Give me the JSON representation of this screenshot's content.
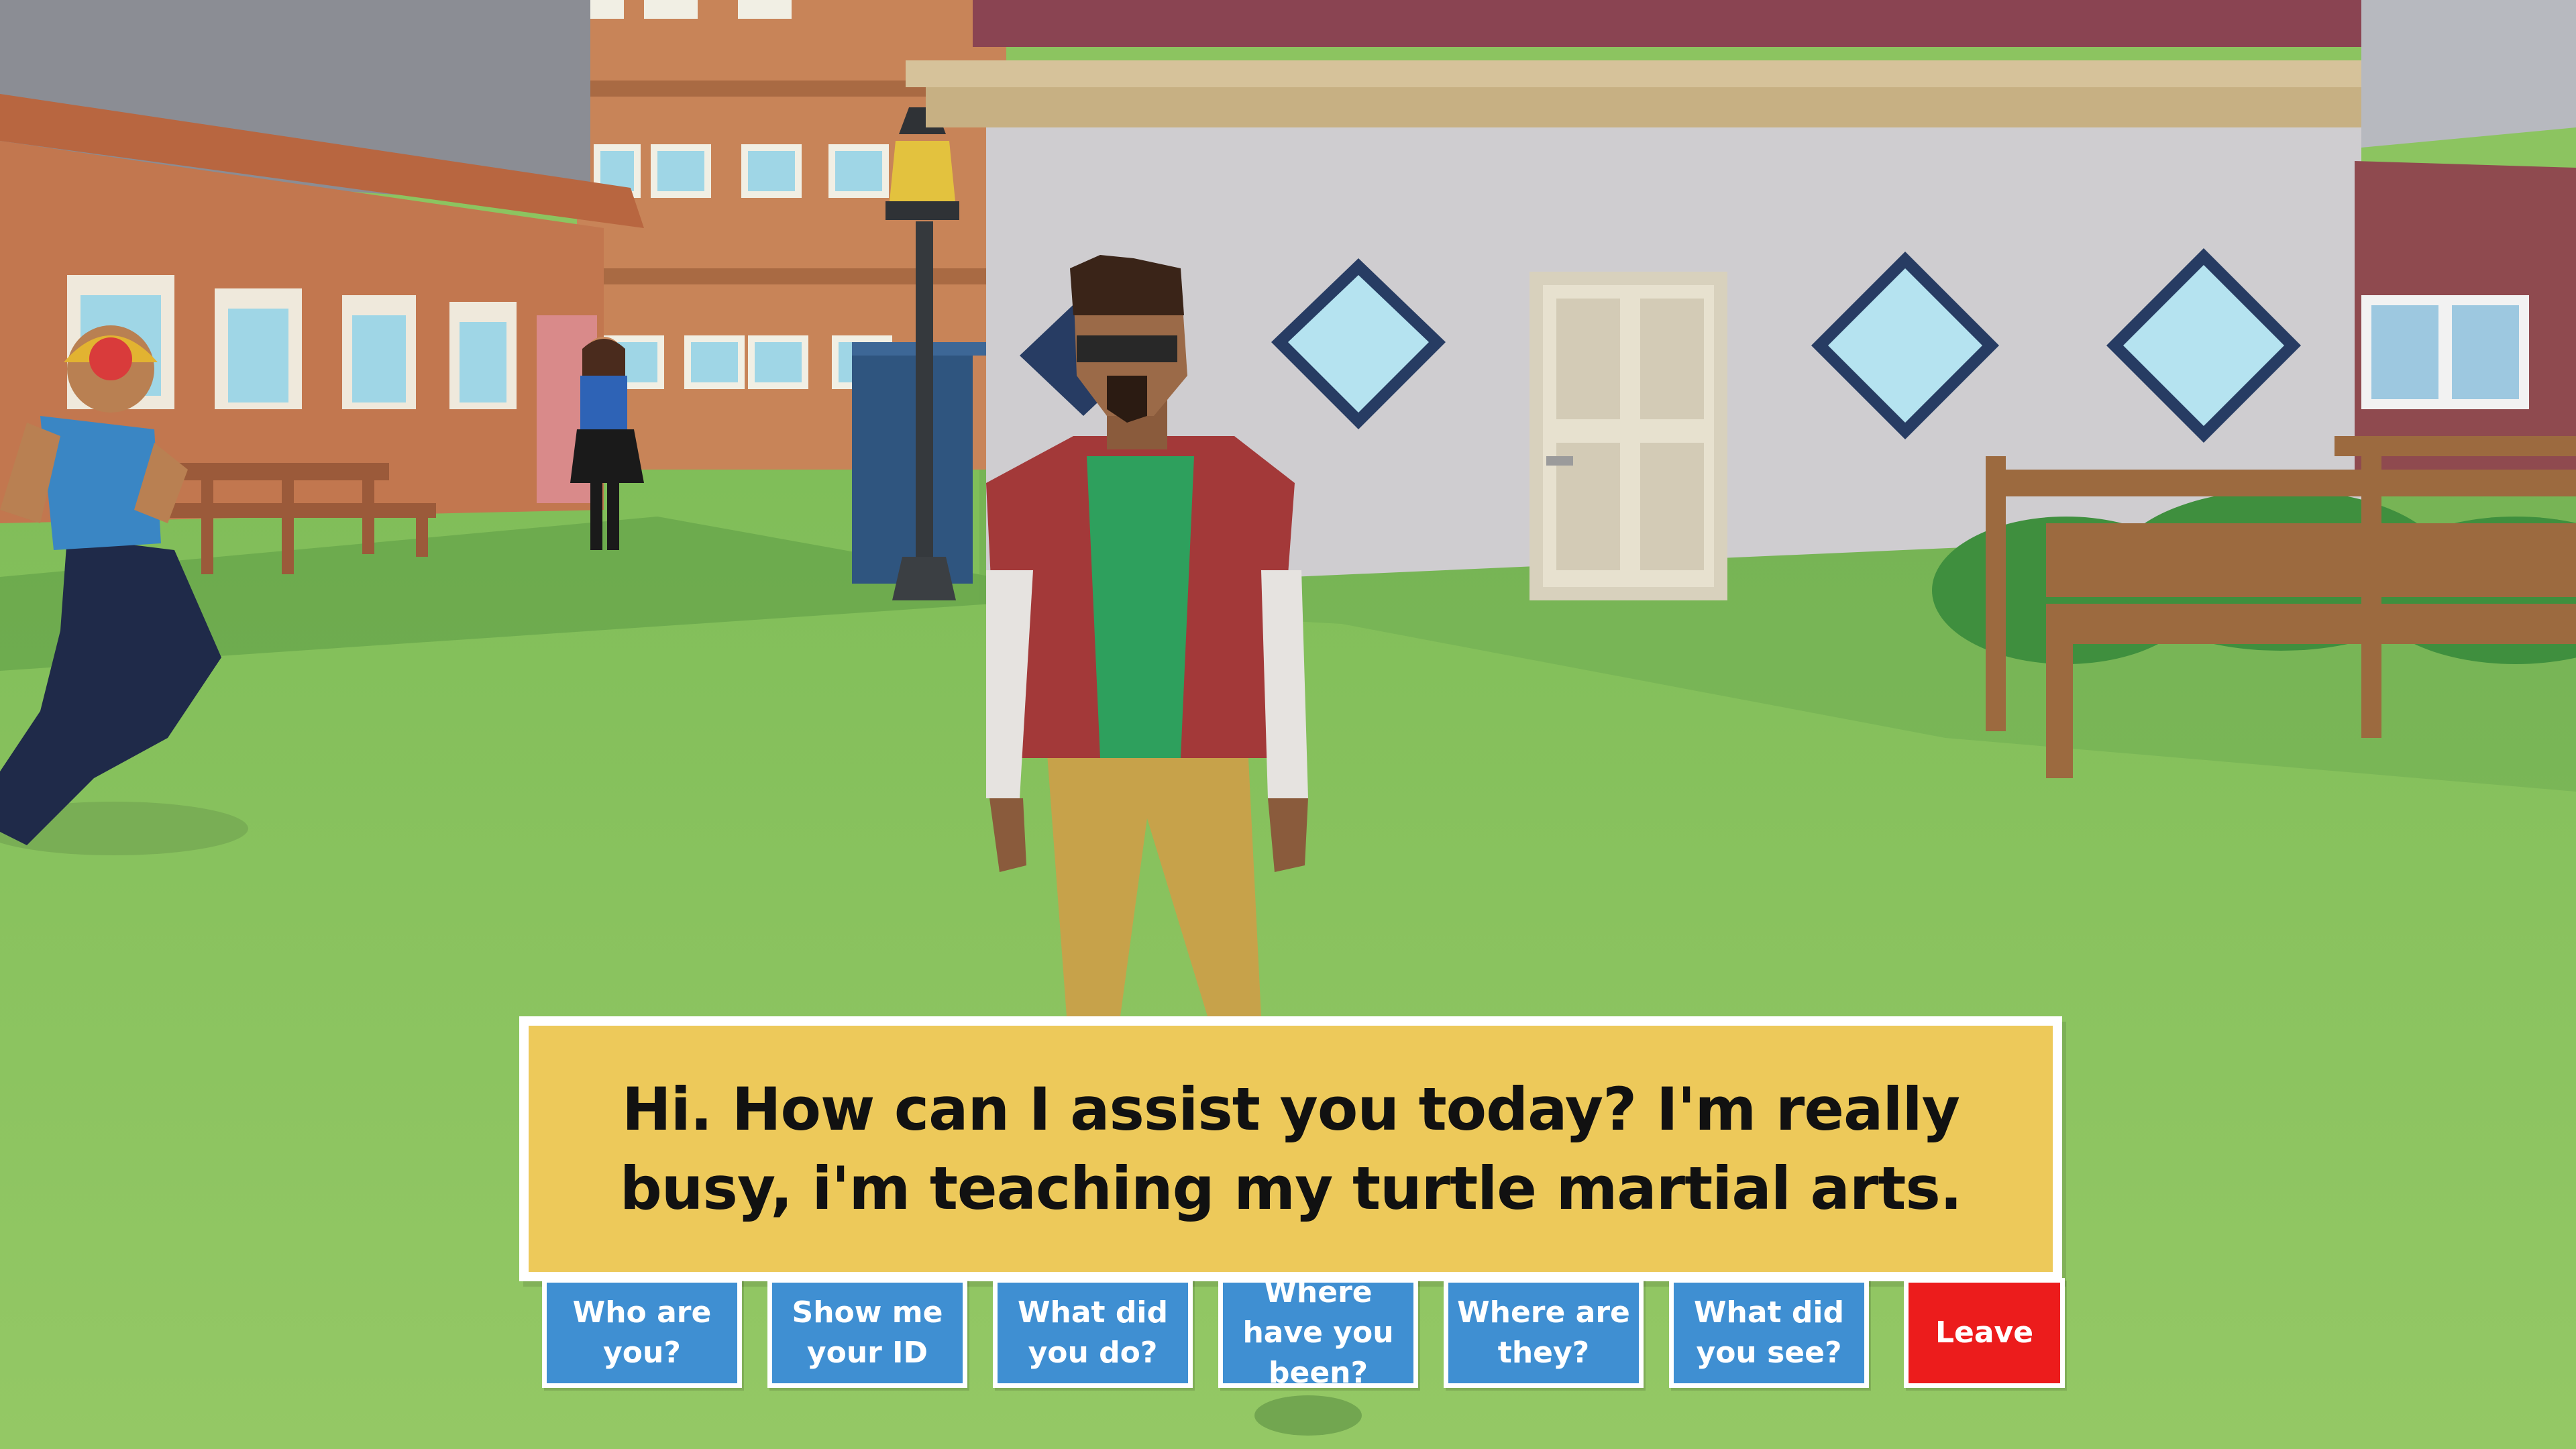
{
  "dialogue": {
    "text": "Hi. How can I assist you today? I'm really busy, i'm teaching my turtle martial arts."
  },
  "choices": [
    {
      "id": "who",
      "label": "Who are you?"
    },
    {
      "id": "id",
      "label": "Show me your ID"
    },
    {
      "id": "do",
      "label": "What did you do?"
    },
    {
      "id": "been",
      "label": "Where have you been?"
    },
    {
      "id": "they",
      "label": "Where are they?"
    },
    {
      "id": "see",
      "label": "What did you see?"
    },
    {
      "id": "leave",
      "label": "Leave"
    }
  ],
  "colors": {
    "dialogue_bg": "#edc95a",
    "choice_bg": "#3f8fd2",
    "leave_bg": "#ec1c1c",
    "grass": "#8cc460"
  }
}
